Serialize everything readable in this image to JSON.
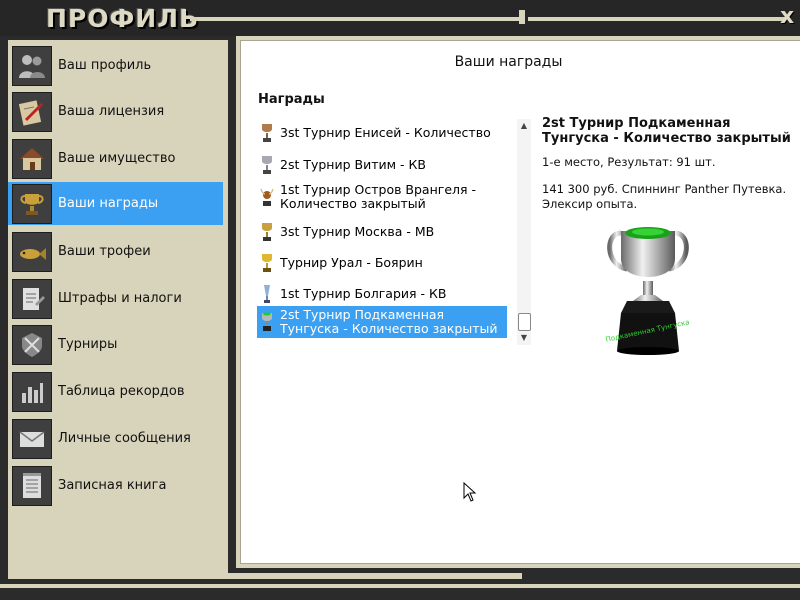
{
  "window": {
    "title": "ПРОФИЛЬ",
    "close_label": "x"
  },
  "sidebar": {
    "items": [
      {
        "label": "Ваш профиль",
        "icon": "people-icon",
        "active": false
      },
      {
        "label": "Ваша лицензия",
        "icon": "license-icon",
        "active": false
      },
      {
        "label": "Ваше имущество",
        "icon": "house-icon",
        "active": false
      },
      {
        "label": "Ваши награды",
        "icon": "cup-icon",
        "active": true
      },
      {
        "label": "Ваши трофеи",
        "icon": "fish-icon",
        "active": false
      },
      {
        "label": "Штрафы и налоги",
        "icon": "document-icon",
        "active": false
      },
      {
        "label": "Турниры",
        "icon": "swords-icon",
        "active": false
      },
      {
        "label": "Таблица рекордов",
        "icon": "bar-chart-icon",
        "active": false
      },
      {
        "label": "Личные сообщения",
        "icon": "envelope-icon",
        "active": false
      },
      {
        "label": "Записная книга",
        "icon": "notebook-icon",
        "active": false
      }
    ]
  },
  "main": {
    "title": "Ваши награды",
    "section_label": "Награды",
    "awards": [
      {
        "label": "3st Турнир Енисей - Количество",
        "icon": "bronze-cup-icon",
        "selected": false
      },
      {
        "label": "2st Турнир Витим - КВ",
        "icon": "silver-cup-icon",
        "selected": false
      },
      {
        "label": "1st Турнир Остров Врангеля - Количество закрытый",
        "icon": "horned-trophy-icon",
        "selected": false
      },
      {
        "label": "3st Турнир Москва - МВ",
        "icon": "gold-bronze-cup-icon",
        "selected": false
      },
      {
        "label": "Турнир Урал - Боярин",
        "icon": "gold-cup-icon",
        "selected": false
      },
      {
        "label": "1st Турнир Болгария - КВ",
        "icon": "blue-cup-icon",
        "selected": false
      },
      {
        "label": "2st Турнир Подкаменная Тунгуска - Количество закрытый",
        "icon": "green-cup-icon",
        "selected": true
      }
    ],
    "detail": {
      "title": "2st Турнир Подкаменная Тунгуска - Количество закрытый",
      "result": "1-е место, Результат: 91 шт.",
      "prize": "141 300 руб. Спиннинг Panther Путевка. Элексир опыта.",
      "trophy_engraving": "Подкаменная Тунгуска"
    }
  },
  "colors": {
    "accent": "#3ba0f2",
    "frame": "#d8d4bb",
    "background": "#2b2b2b"
  }
}
